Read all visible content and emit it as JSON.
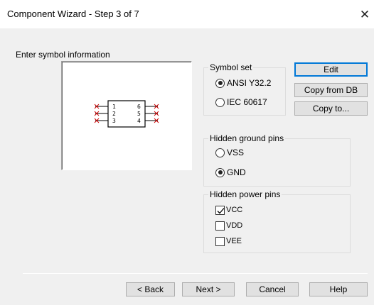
{
  "window": {
    "title": "Component Wizard - Step 3 of 7",
    "close_glyph": "✕"
  },
  "prompt": "Enter symbol information",
  "preview": {
    "left_pins": [
      "1",
      "2",
      "3"
    ],
    "right_pins": [
      "6",
      "5",
      "4"
    ]
  },
  "symbol_set": {
    "label": "Symbol set",
    "options": [
      "ANSI Y32.2",
      "IEC 60617"
    ],
    "selected": "ANSI Y32.2"
  },
  "side_buttons": {
    "edit": "Edit",
    "copy_from_db": "Copy from DB",
    "copy_to": "Copy to..."
  },
  "hidden_ground_pins": {
    "label": "Hidden ground pins",
    "options": [
      "VSS",
      "GND"
    ],
    "selected": "GND"
  },
  "hidden_power_pins": {
    "label": "Hidden power pins",
    "items": [
      {
        "label": "VCC",
        "checked": true
      },
      {
        "label": "VDD",
        "checked": false
      },
      {
        "label": "VEE",
        "checked": false
      }
    ]
  },
  "footer": {
    "back": "< Back",
    "next": "Next >",
    "cancel": "Cancel",
    "help": "Help"
  },
  "colors": {
    "pin_marker": "#cc0000",
    "default_button_border": "#0078d7"
  }
}
